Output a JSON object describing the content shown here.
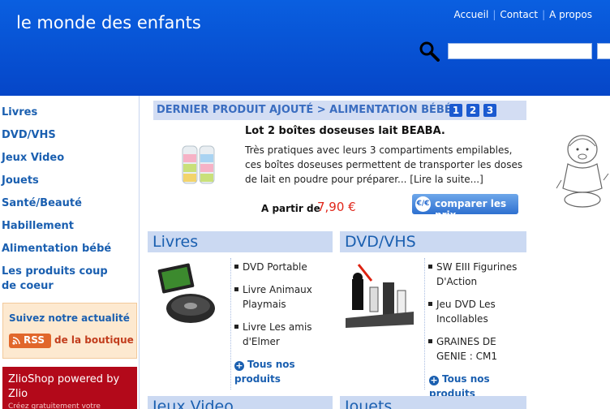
{
  "header": {
    "title": "le monde des enfants",
    "nav": [
      "Accueil",
      "Contact",
      "A propos"
    ],
    "search_value": ""
  },
  "sidebar": {
    "categories": [
      "Livres",
      "DVD/VHS",
      "Jeux Video",
      "Jouets",
      "Santé/Beauté",
      "Habillement",
      "Alimentation bébé",
      "Les produits coup de coeur"
    ],
    "news": {
      "title": "Suivez notre actualité",
      "rss_label": "RSS",
      "rss_text": "de la boutique"
    },
    "zlio": {
      "title": "ZlioShop powered by Zlio",
      "subtitle": "Créez gratuitement votre"
    }
  },
  "featured": {
    "label": "DERNIER PRODUIT AJOUTÉ > ALIMENTATION BÉBÉ",
    "pages": [
      "1",
      "2",
      "3"
    ],
    "product_title": "Lot 2 boîtes doseuses lait BEABA.",
    "description": "Très pratiques avec leurs 3 compartiments empilables, ces boîtes doseuses permettent de transporter les doses de lait en poudre pour préparer... [Lire la suite...]",
    "price_label": "A partir de",
    "price": "7,90 €",
    "compare_icon": "€/€",
    "compare_label": "comparer les prix"
  },
  "sections": {
    "livres": {
      "title": "Livres",
      "items": [
        "DVD Portable",
        "Livre Animaux Playmais",
        "Livre Les amis d'Elmer"
      ],
      "more": "Tous nos produits"
    },
    "dvd": {
      "title": "DVD/VHS",
      "items": [
        "SW EIII Figurines D'Action",
        "Jeu DVD Les Incollables",
        "GRAINES DE GENIE : CM1"
      ],
      "more": "Tous nos produits"
    },
    "jeux": {
      "title": "Jeux Video"
    },
    "jouets": {
      "title": "Jouets"
    }
  },
  "colors": {
    "header_blue": "#0a5fe0",
    "link_blue": "#1a5fb0",
    "price_red": "#e0261a",
    "zlio_red": "#b3091a"
  }
}
